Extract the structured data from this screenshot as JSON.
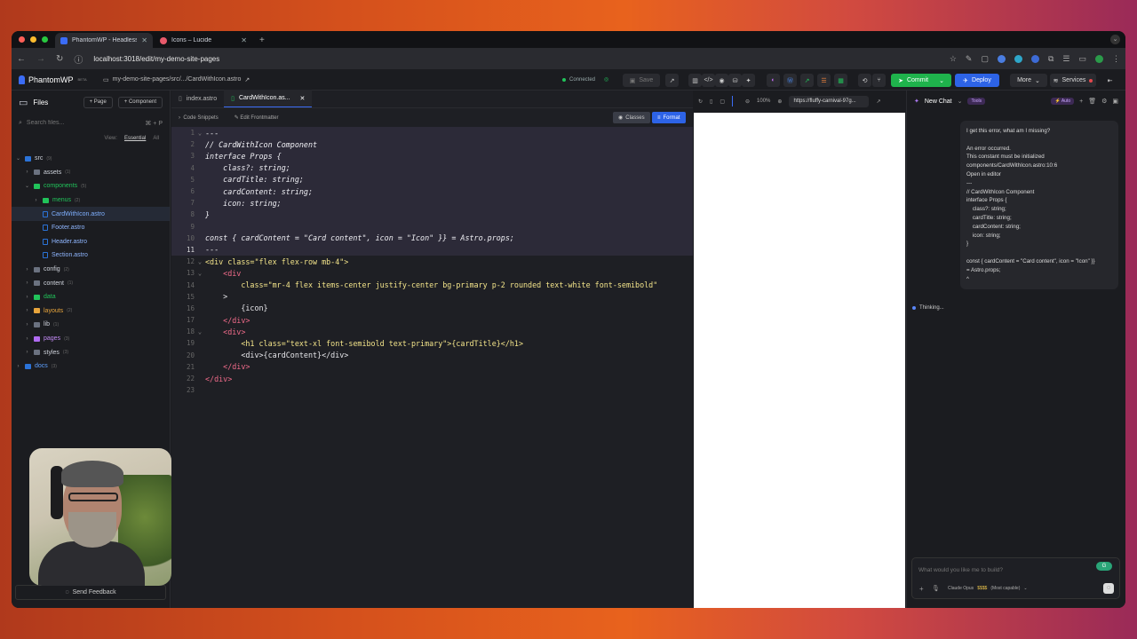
{
  "browser": {
    "tabs": [
      {
        "label": "PhantomWP - Headless Word...",
        "active": true
      },
      {
        "label": "Icons – Lucide",
        "active": false
      }
    ],
    "new_tab": "+",
    "url": "localhost:3018/edit/my-demo-site-pages"
  },
  "app": {
    "brand": "PhantomWP",
    "brand_badge": "BETA",
    "breadcrumb": "my-demo-site-pages/src/.../CardWithIcon.astro",
    "connection": "Connected",
    "save": "Save",
    "commit": "Commit",
    "deploy": "Deploy",
    "more": "More",
    "services": "Services"
  },
  "sidebar": {
    "title": "Files",
    "add_page": "Page",
    "add_component": "Component",
    "search_placeholder": "Search files...",
    "search_shortcut": "⌘ + P",
    "view_label": "View:",
    "view_essential": "Essential",
    "view_all": "All",
    "tree": [
      {
        "label": "src",
        "count": "(9)",
        "depth": 0,
        "type": "folder",
        "open": true
      },
      {
        "label": "assets",
        "count": "(1)",
        "depth": 1,
        "type": "folder"
      },
      {
        "label": "components",
        "count": "(5)",
        "depth": 1,
        "type": "folder",
        "open": true
      },
      {
        "label": "menus",
        "count": "(2)",
        "depth": 2,
        "type": "folder"
      },
      {
        "label": "CardWithIcon.astro",
        "count": "",
        "depth": 2,
        "type": "file",
        "selected": true
      },
      {
        "label": "Footer.astro",
        "count": "",
        "depth": 2,
        "type": "file"
      },
      {
        "label": "Header.astro",
        "count": "",
        "depth": 2,
        "type": "file"
      },
      {
        "label": "Section.astro",
        "count": "",
        "depth": 2,
        "type": "file"
      },
      {
        "label": "config",
        "count": "(2)",
        "depth": 1,
        "type": "folder"
      },
      {
        "label": "content",
        "count": "(1)",
        "depth": 1,
        "type": "folder"
      },
      {
        "label": "data",
        "count": "",
        "depth": 1,
        "type": "folder"
      },
      {
        "label": "layouts",
        "count": "(2)",
        "depth": 1,
        "type": "folder"
      },
      {
        "label": "lib",
        "count": "(1)",
        "depth": 1,
        "type": "folder"
      },
      {
        "label": "pages",
        "count": "(3)",
        "depth": 1,
        "type": "folder"
      },
      {
        "label": "styles",
        "count": "(3)",
        "depth": 1,
        "type": "folder"
      },
      {
        "label": "docs",
        "count": "(3)",
        "depth": 0,
        "type": "folder"
      }
    ],
    "feedback": "Send Feedback"
  },
  "editor": {
    "tabs": [
      {
        "label": "index.astro",
        "active": false
      },
      {
        "label": "CardWithIcon.as...",
        "active": true
      }
    ],
    "toolbar": {
      "snippets": "Code Snippets",
      "frontmatter": "Edit Frontmatter",
      "classes": "Classes",
      "format": "Format"
    },
    "lines": [
      "---",
      "// CardWithIcon Component",
      "interface Props {",
      "    class?: string;",
      "    cardTitle: string;",
      "    cardContent: string;",
      "    icon: string;",
      "}",
      "",
      "const { cardContent = \"Card content\", icon = \"Icon\" }} = Astro.props;",
      "---",
      "<div class=\"flex flex-row mb-4\">",
      "    <div",
      "        class=\"mr-4 flex items-center justify-center bg-primary p-2 rounded text-white font-semibold\"",
      "    >",
      "        {icon}",
      "    </div>",
      "    <div>",
      "        <h1 class=\"text-xl font-semibold text-primary\">{cardTitle}</h1>",
      "        <div>{cardContent}</div>",
      "    </div>",
      "</div>",
      ""
    ]
  },
  "preview": {
    "zoom": "100%",
    "url": "https://fluffy-carnival-97g..."
  },
  "chat": {
    "title": "New Chat",
    "tools_badge": "Tools",
    "auto": "Auto",
    "message": "I get this error, what am I missing?\n\nAn error occurred.\nThis constant must be initialized\ncomponents/CardWithIcon.astro:10:6\nOpen in editor\n---\n// CardWithIcon Component\ninterface Props {\n    class?: string;\n    cardTitle: string;\n    cardContent: string;\n    icon: string;\n}\n\nconst { cardContent = \"Card content\", icon = \"Icon\" }}\n= Astro.props;\n^",
    "thinking": "Thinking...",
    "placeholder": "What would you like me to build?",
    "model": "Claude Opus",
    "model_cost": "$$$$",
    "model_note": "(Most capable)"
  }
}
